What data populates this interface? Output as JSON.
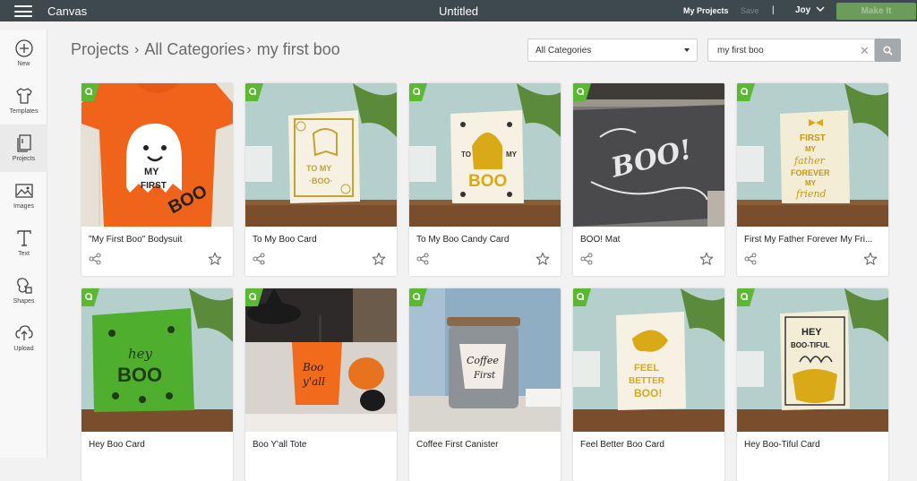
{
  "topbar": {
    "app_name": "Canvas",
    "doc_title": "Untitled",
    "my_projects": "My Projects",
    "save": "Save",
    "divider": "|",
    "user": "Joy",
    "make_it": "Make It"
  },
  "sidebar": {
    "items": [
      {
        "label": "New",
        "icon": "plus-circle-icon"
      },
      {
        "label": "Templates",
        "icon": "tshirt-icon"
      },
      {
        "label": "Projects",
        "icon": "projects-icon"
      },
      {
        "label": "Images",
        "icon": "image-icon"
      },
      {
        "label": "Text",
        "icon": "text-icon"
      },
      {
        "label": "Shapes",
        "icon": "shapes-icon"
      },
      {
        "label": "Upload",
        "icon": "upload-icon"
      }
    ]
  },
  "breadcrumb": {
    "projects": "Projects",
    "categories": "All Categories",
    "query": "my first boo"
  },
  "filter": {
    "category": "All Categories",
    "search_value": "my first boo"
  },
  "projects": [
    {
      "title": "\"My First Boo\" Bodysuit"
    },
    {
      "title": "To My Boo Card"
    },
    {
      "title": "To My Boo Candy Card"
    },
    {
      "title": "BOO! Mat"
    },
    {
      "title": "First My Father Forever My Fri..."
    },
    {
      "title": "Hey Boo Card"
    },
    {
      "title": "Boo Y'all Tote"
    },
    {
      "title": "Coffee First Canister"
    },
    {
      "title": "Feel Better Boo Card"
    },
    {
      "title": "Hey Boo-Tiful Card"
    }
  ],
  "colors": {
    "topbar": "#3e484f",
    "make_button": "#6b9c5a",
    "access_badge": "#5bb832"
  }
}
